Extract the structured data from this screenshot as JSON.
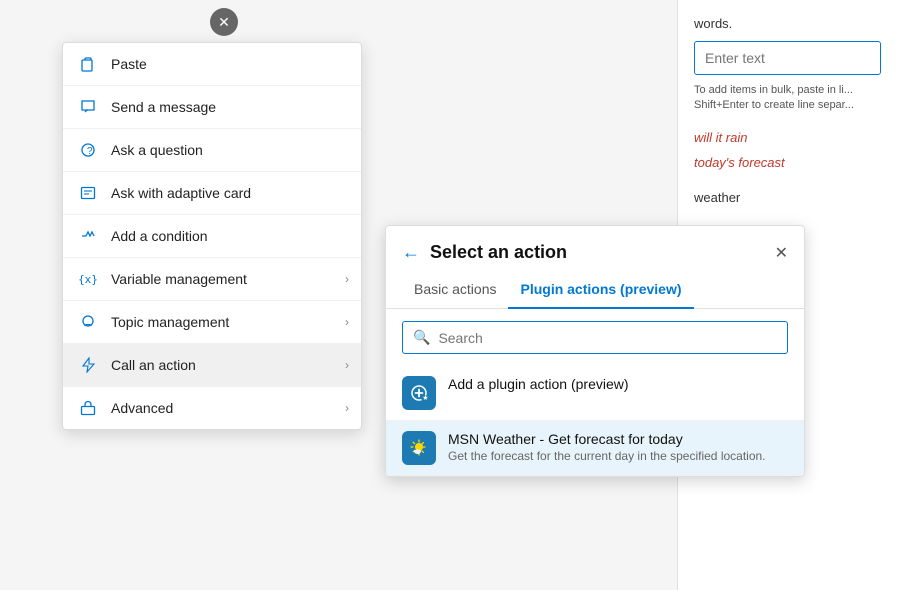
{
  "close_btn": "✕",
  "bg_panel": {
    "words_text": "words.",
    "enter_text_placeholder": "Enter text",
    "hint_text": "To add items in bulk, paste in li...\nShift+Enter to create line separ...",
    "tag1": "will it rain",
    "tag2": "today's forecast",
    "weather_label": "weather"
  },
  "context_menu": {
    "items": [
      {
        "id": "paste",
        "icon": "📋",
        "label": "Paste",
        "has_arrow": false
      },
      {
        "id": "send-message",
        "icon": "💬",
        "label": "Send a message",
        "has_arrow": false
      },
      {
        "id": "ask-question",
        "icon": "❓",
        "label": "Ask a question",
        "has_arrow": false
      },
      {
        "id": "ask-adaptive-card",
        "icon": "⊞",
        "label": "Ask with adaptive card",
        "has_arrow": false
      },
      {
        "id": "add-condition",
        "icon": "⎇",
        "label": "Add a condition",
        "has_arrow": false
      },
      {
        "id": "variable-management",
        "icon": "{x}",
        "label": "Variable management",
        "has_arrow": true
      },
      {
        "id": "topic-management",
        "icon": "💭",
        "label": "Topic management",
        "has_arrow": true
      },
      {
        "id": "call-action",
        "icon": "⚡",
        "label": "Call an action",
        "has_arrow": true,
        "active": true
      },
      {
        "id": "advanced",
        "icon": "🧰",
        "label": "Advanced",
        "has_arrow": true
      }
    ]
  },
  "action_panel": {
    "back_label": "←",
    "title": "Select an action",
    "close_label": "✕",
    "tabs": [
      {
        "id": "basic",
        "label": "Basic actions",
        "active": false
      },
      {
        "id": "plugin",
        "label": "Plugin actions (preview)",
        "active": true
      }
    ],
    "search_placeholder": "Search",
    "actions": [
      {
        "id": "add-plugin",
        "icon": "⊕",
        "name": "Add a plugin action (preview)",
        "desc": ""
      },
      {
        "id": "msn-weather",
        "icon": "☀",
        "name": "MSN Weather - Get forecast for today",
        "desc": "Get the forecast for the current day in the specified location."
      }
    ]
  }
}
